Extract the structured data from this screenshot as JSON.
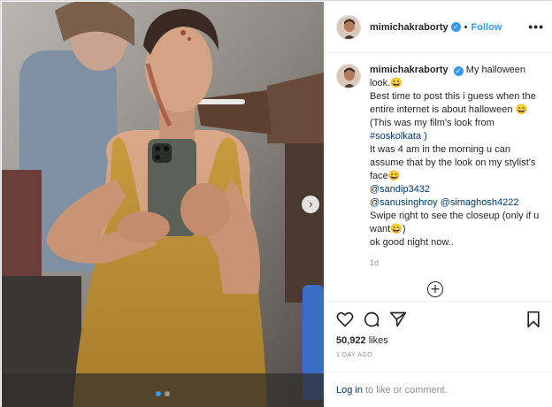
{
  "post": {
    "username": "mimichakraborty",
    "follow_label": "Follow",
    "separator": "•",
    "more_label": "•••",
    "verified_glyph": "✓"
  },
  "caption": {
    "lines": [
      "My halloween look.😄",
      "Best time to post this i guess when the entire internet is about halloween 😄",
      "(This was my film's look from",
      "#soskolkata )",
      "It was 4 am in the morning u can assume that by the look on my stylist's face😄",
      "@sandip3432",
      "@sanusinghroy @simaghosh4222",
      "Swipe right to see the closeup (only if u want😄)",
      "ok good night now.."
    ],
    "timestamp": "1d"
  },
  "icons": {
    "heart": "heart-icon",
    "comment": "comment-icon",
    "share": "share-icon",
    "save": "bookmark-icon",
    "load_more": "plus-circle-icon",
    "carousel_next": "chevron-right-icon"
  },
  "engagement": {
    "likes_count": "50,922",
    "likes_label": "likes",
    "age": "1 DAY AGO"
  },
  "login": {
    "link": "Log in",
    "rest": "to like or comment."
  },
  "carousel": {
    "total": 2,
    "active_index": 0
  },
  "colors": {
    "accent": "#3897f0",
    "text": "#262626",
    "muted": "#8e8e8e",
    "link": "#00376b"
  }
}
